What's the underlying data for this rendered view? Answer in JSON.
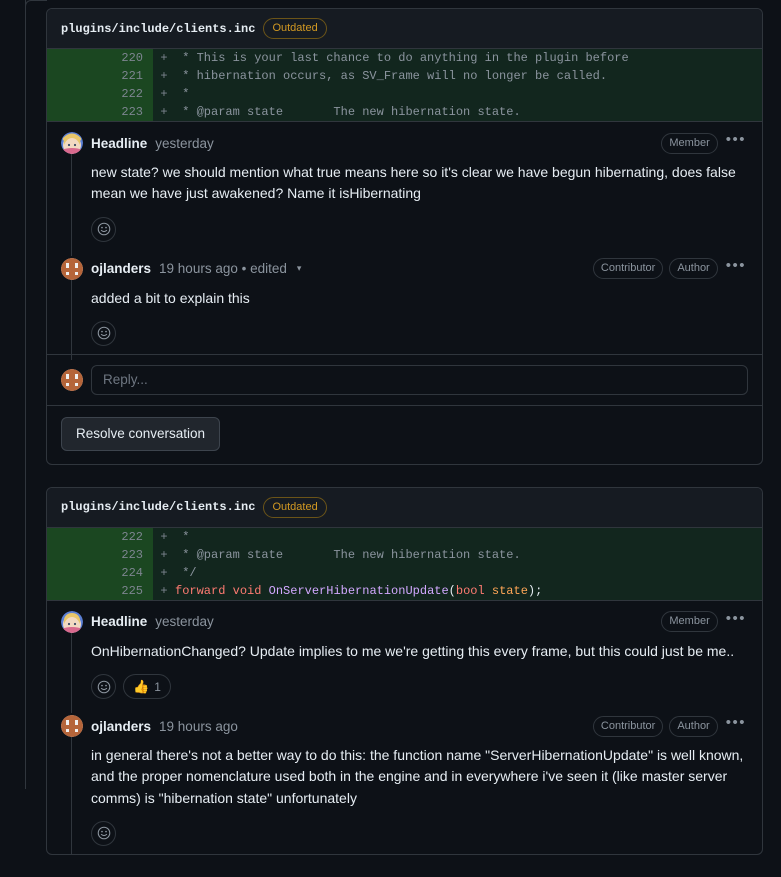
{
  "threads": [
    {
      "file": {
        "path": "plugins/include/clients.inc",
        "badge": "Outdated"
      },
      "diff": [
        {
          "lineno": "220",
          "sign": "+",
          "code": " * This is your last chance to do anything in the plugin before"
        },
        {
          "lineno": "221",
          "sign": "+",
          "code": " * hibernation occurs, as SV_Frame will no longer be called."
        },
        {
          "lineno": "222",
          "sign": "+",
          "code": " *"
        },
        {
          "lineno": "223",
          "sign": "+",
          "code": " * @param state       The new hibernation state."
        }
      ],
      "comments": [
        {
          "author": "Headline",
          "timestamp": "yesterday",
          "edited": "",
          "badges": [
            "Member"
          ],
          "body": "new state? we should mention what true means here so it's clear we have begun hibernating, does false mean we have just awakened? Name it isHibernating",
          "reactions": []
        },
        {
          "author": "ojlanders",
          "timestamp": "19 hours ago • edited",
          "edited": "caret",
          "badges": [
            "Contributor",
            "Author"
          ],
          "body": "added a bit to explain this",
          "reactions": []
        }
      ],
      "reply_placeholder": "Reply...",
      "resolve_label": "Resolve conversation"
    },
    {
      "file": {
        "path": "plugins/include/clients.inc",
        "badge": "Outdated"
      },
      "diff": [
        {
          "lineno": "222",
          "sign": "+",
          "code": " *"
        },
        {
          "lineno": "223",
          "sign": "+",
          "code": " * @param state       The new hibernation state."
        },
        {
          "lineno": "224",
          "sign": "+",
          "code": " */"
        },
        {
          "lineno": "225",
          "sign": "+",
          "code": "forward void OnServerHibernationUpdate(bool state);",
          "highlighted": true
        }
      ],
      "comments": [
        {
          "author": "Headline",
          "timestamp": "yesterday",
          "edited": "",
          "badges": [
            "Member"
          ],
          "body": "OnHibernationChanged? Update implies to me we're getting this every frame, but this could just be me..",
          "reactions": [
            {
              "emoji": "👍",
              "count": "1"
            }
          ]
        },
        {
          "author": "ojlanders",
          "timestamp": "19 hours ago",
          "edited": "",
          "badges": [
            "Contributor",
            "Author"
          ],
          "body": "in general there's not a better way to do this: the function name \"ServerHibernationUpdate\" is well known, and the proper nomenclature used both in the engine and in everywhere i've seen it (like master server comms) is \"hibernation state\" unfortunately",
          "reactions": []
        }
      ],
      "reply_placeholder": "",
      "resolve_label": ""
    }
  ],
  "syntax": {
    "keyword_forward": "forward",
    "keyword_void": "void",
    "function_name": "OnServerHibernationUpdate",
    "open_paren": "(",
    "keyword_bool": "bool",
    "param_state": " state",
    "close_paren": ");"
  },
  "colors": {
    "background": "#0d1117",
    "border": "#30363d",
    "diff_add_bg": "#12261e",
    "diff_gutter_bg": "#1b4721",
    "badge_outdated": "#d29922",
    "keyword": "#ff7b72",
    "function": "#d2a8ff",
    "param": "#ffa657",
    "muted_text": "#8b949e",
    "body_text": "#e6edf3"
  },
  "icons": {
    "add_reaction": "smiley-plus-icon",
    "kebab": "kebab-horizontal-icon",
    "caret": "▾"
  }
}
